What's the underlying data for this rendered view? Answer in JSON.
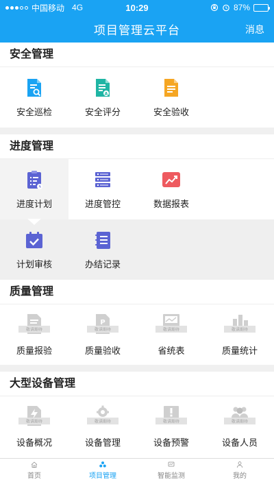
{
  "status_bar": {
    "carrier": "中国移动",
    "network": "4G",
    "time": "10:29",
    "battery": "87%",
    "battery_level": 0.87
  },
  "header": {
    "title": "项目管理云平台",
    "action": "消息"
  },
  "sections": [
    {
      "title": "安全管理",
      "items": [
        {
          "label": "安全巡检",
          "icon": "doc-search-icon"
        },
        {
          "label": "安全评分",
          "icon": "doc-score-icon"
        },
        {
          "label": "安全验收",
          "icon": "doc-accept-icon"
        }
      ]
    },
    {
      "title": "进度管理",
      "items": [
        {
          "label": "进度计划",
          "icon": "plan-clipboard-icon"
        },
        {
          "label": "进度管控",
          "icon": "server-stack-icon"
        },
        {
          "label": "数据报表",
          "icon": "trend-chart-icon"
        },
        {
          "label": "计划审核",
          "icon": "calendar-check-icon"
        },
        {
          "label": "办结记录",
          "icon": "notebook-icon"
        }
      ]
    },
    {
      "title": "质量管理",
      "badge": "敬请期待",
      "items": [
        {
          "label": "质量报验",
          "icon": "doc-pending-icon"
        },
        {
          "label": "质量验收",
          "icon": "parking-doc-pending-icon"
        },
        {
          "label": "省统表",
          "icon": "monitor-pending-icon"
        },
        {
          "label": "质量统计",
          "icon": "bar-chart-pending-icon"
        }
      ]
    },
    {
      "title": "大型设备管理",
      "badge": "敬请期待",
      "items": [
        {
          "label": "设备概况",
          "icon": "lightning-doc-pending-icon"
        },
        {
          "label": "设备管理",
          "icon": "gear-pending-icon"
        },
        {
          "label": "设备预警",
          "icon": "warning-board-pending-icon"
        },
        {
          "label": "设备人员",
          "icon": "people-pending-icon"
        }
      ]
    }
  ],
  "tabs": [
    {
      "label": "首页",
      "icon": "home-icon"
    },
    {
      "label": "项目管理",
      "icon": "cluster-icon"
    },
    {
      "label": "智能监测",
      "icon": "monitor-icon"
    },
    {
      "label": "我的",
      "icon": "person-icon"
    }
  ],
  "active_tab_index": 1,
  "colors": {
    "primary": "#1aa3f3",
    "teal": "#1fb5a4",
    "orange": "#f5a623",
    "purple": "#5b63d3",
    "red": "#ee5a5f",
    "disabled": "#c9c9c9"
  }
}
